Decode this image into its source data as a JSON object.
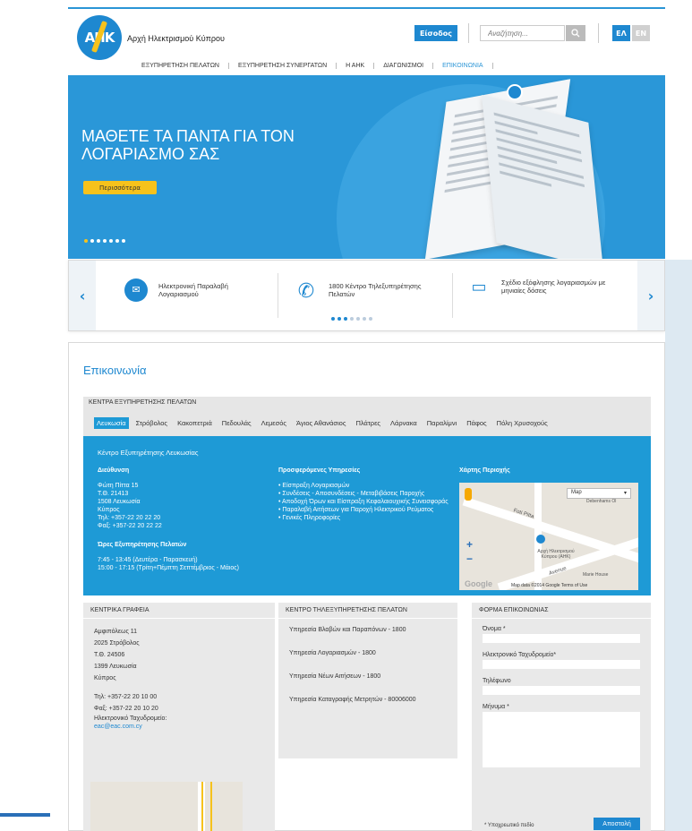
{
  "header": {
    "logo_text": "ΑΗΚ",
    "org_name": "Αρχή Ηλεκτρισμού Κύπρου",
    "login_label": "Είσοδος",
    "search_placeholder": "Αναζήτηση...",
    "lang_el": "ΕΛ",
    "lang_en": "EN"
  },
  "nav": {
    "items": [
      "ΕΞΥΠΗΡΕΤΗΣΗ ΠΕΛΑΤΩΝ",
      "ΕΞΥΠΗΡΕΤΗΣΗ ΣΥΝΕΡΓΑΤΩΝ",
      "Η ΑΗΚ",
      "ΔΙΑΓΩΝΙΣΜΟΙ",
      "ΕΠΙΚΟΙΝΩΝΙΑ"
    ],
    "active": "ΕΠΙΚΟΙΝΩΝΙΑ"
  },
  "hero": {
    "title": "ΜΑΘΕΤΕ ΤΑ ΠΑΝΤΑ ΓΙΑ ΤΟΝ ΛΟΓΑΡΙΑΣΜΟ ΣΑΣ",
    "button": "Περισσότερα",
    "slides": 7,
    "active_slide": 1
  },
  "services": {
    "prev": "‹",
    "next": "›",
    "items": [
      {
        "icon": "email-icon",
        "label": "Ηλεκτρονική Παραλαβή Λογαριασμού"
      },
      {
        "icon": "phone-icon",
        "label": "1800 Κέντρο Τηλεξυπηρέτησης Πελατών"
      },
      {
        "icon": "card-icon",
        "label": "Σχέδιο εξόφλησης λογαριασμών με μηνιαίες δόσεις"
      }
    ]
  },
  "contact": {
    "title": "Επικοινωνία",
    "centers_title": "ΚΕΝΤΡΑ ΕΞΥΠΗΡΕΤΗΣΗΣ ΠΕΛΑΤΩΝ",
    "cities": [
      "Λευκωσία",
      "Στρόβολος",
      "Κακοπετριά",
      "Πεδουλάς",
      "Λεμεσός",
      "Άγιος Αθανάσιος",
      "Πλάτρες",
      "Λάρνακα",
      "Παραλίμνι",
      "Πάφος",
      "Πόλη Χρυσοχούς"
    ],
    "active_city": "Λευκωσία",
    "panel_title": "Κέντρο Εξυπηρέτησης Λευκωσίας",
    "address_title": "Διεύθυνση",
    "address_lines": [
      "Φώτη Πίττα 15",
      "Τ.Θ. 21413",
      "1508 Λευκωσία",
      "Κύπρος",
      "Τηλ: +357-22 20 22 20",
      "Φαξ: +357-22 20 22 22"
    ],
    "hours_title": "Ώρες Εξυπηρέτησης Πελατών",
    "hours_lines": [
      "7:45 - 13:45 (Δευτέρα - Παρασκευή)",
      "15:00 - 17:15 (Τρίτη+Πέμπτη Σεπτέμβριος - Μάιος)"
    ],
    "services_title": "Προσφερόμενες Υπηρεσίες",
    "services_list": [
      "Είσπραξη Λογαριασμών",
      "Συνδέσεις - Αποσυνδέσεις - Μεταβιβάσεις Παροχής",
      "Αποδοχή Όρων και Είσπραξη Κεφαλαιουχικής Συνεισφοράς",
      "Παραλαβή Αιτήσεων για Παροχή Ηλεκτρικού Ρεύματος",
      "Γενικές Πληροφορίες"
    ],
    "map_title": "Χάρτης Περιοχής",
    "map": {
      "type": "Map",
      "street": "Foti Pitta",
      "place": "Αρχή Ηλεκτρισμού Κύπρου (ΑΗΚ)",
      "place2": "Marie House",
      "street2": "Avenue",
      "place3": "Debenhams Ol",
      "attribution": "Map data ©2014 Google   Terms of Use",
      "google": "Google"
    }
  },
  "head_office": {
    "title": "ΚΕΝΤΡΙΚΑ ΓΡΑΦΕΙΑ",
    "lines": [
      "Αμφιπόλεως 11",
      "2025 Στρόβολος",
      "Τ.Θ. 24506",
      "1399 Λευκωσία",
      "Κύπρος"
    ],
    "tel": "Τηλ: +357-22 20 10 00",
    "fax": "Φαξ: +357-22 20 10 20",
    "email_label": "Ηλεκτρονικό Ταχυδρομείο:",
    "email": "eac@eac.com.cy"
  },
  "call_center": {
    "title": "ΚΕΝΤΡΟ ΤΗΛΕΞΥΠΗΡΕΤΗΣΗΣ ΠΕΛΑΤΩΝ",
    "items": [
      "Υπηρεσία Βλαβών και Παραπόνων - 1800",
      "Υπηρεσία Λογαριασμών - 1800",
      "Υπηρεσία Νέων Αιτήσεων - 1800",
      "Υπηρεσία Καταγραφής Μετρητών - 80006000"
    ]
  },
  "form": {
    "title": "ΦΟΡΜΑ ΕΠΙΚΟΙΝΩΝΙΑΣ",
    "name_label": "Όνομα *",
    "email_label": "Ηλεκτρονικό Ταχυδρομείο*",
    "phone_label": "Τηλέφωνο",
    "message_label": "Μήνυμα *",
    "required_note": "* Υποχρεωτικό πεδίο",
    "send": "Αποστολή"
  }
}
